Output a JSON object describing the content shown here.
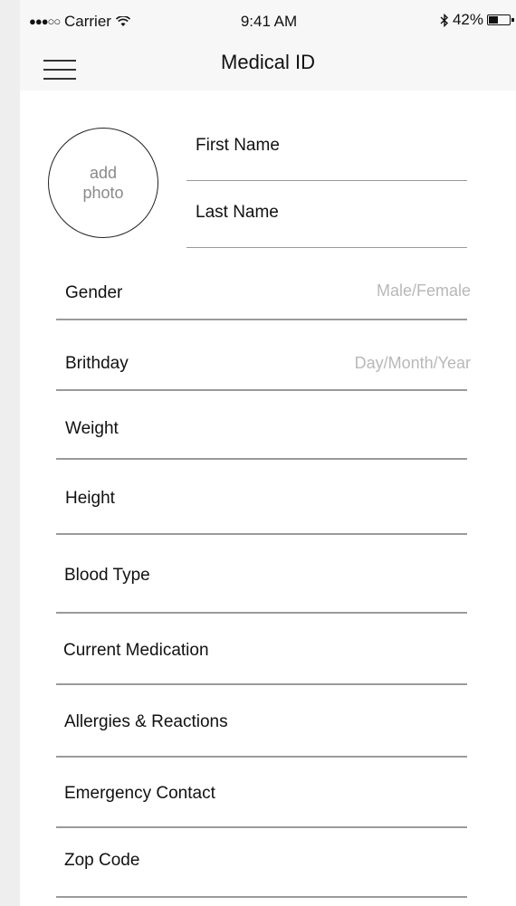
{
  "status_bar": {
    "signal": "●●●○○",
    "carrier": "Carrier",
    "wifi_icon": "wifi-icon",
    "time": "9:41 AM",
    "bluetooth_icon": "bluetooth-icon",
    "battery": "42%"
  },
  "nav": {
    "menu_icon": "hamburger-menu-icon",
    "title": "Medical ID"
  },
  "profile": {
    "photo_line1": "add",
    "photo_line2": "photo",
    "first_name_label": "First Name",
    "last_name_label": "Last Name"
  },
  "fields": [
    {
      "label": "Gender",
      "placeholder": "Male/Female"
    },
    {
      "label": "Brithday",
      "placeholder": "Day/Month/Year"
    },
    {
      "label": "Weight",
      "placeholder": ""
    },
    {
      "label": "Height",
      "placeholder": ""
    },
    {
      "label": "Blood Type",
      "placeholder": ""
    },
    {
      "label": "Current Medication",
      "placeholder": ""
    },
    {
      "label": "Allergies & Reactions",
      "placeholder": ""
    },
    {
      "label": "Emergency Contact",
      "placeholder": ""
    },
    {
      "label": "Zop Code",
      "placeholder": ""
    }
  ]
}
